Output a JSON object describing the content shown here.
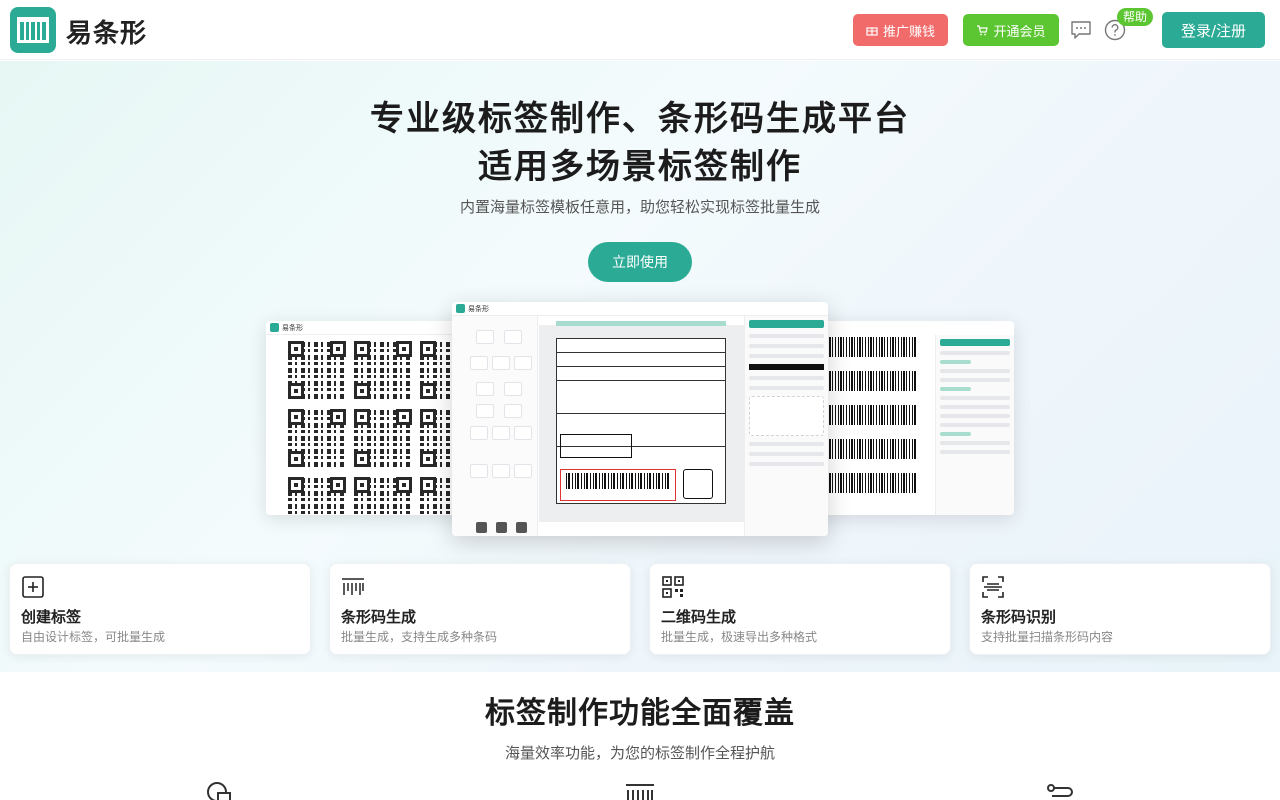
{
  "header": {
    "brand": "易条形",
    "promo_label": "推广赚钱",
    "vip_label": "开通会员",
    "help_badge": "帮助",
    "login_label": "登录/注册"
  },
  "hero": {
    "title_line1": "专业级标签制作、条形码生成平台",
    "title_line2": "适用多场景标签制作",
    "subtitle": "内置海量标签模板任意用，助您轻松实现标签批量生成",
    "cta_label": "立即使用",
    "preview_brand": "易条形"
  },
  "features": [
    {
      "title": "创建标签",
      "desc": "自由设计标签，可批量生成",
      "icon": "plus-square-icon"
    },
    {
      "title": "条形码生成",
      "desc": "批量生成，支持生成多种条码",
      "icon": "barcode-icon"
    },
    {
      "title": "二维码生成",
      "desc": "批量生成，极速导出多种格式",
      "icon": "qrcode-icon"
    },
    {
      "title": "条形码识别",
      "desc": "支持批量扫描条形码内容",
      "icon": "scan-icon"
    }
  ],
  "section2": {
    "title": "标签制作功能全面覆盖",
    "subtitle": "海量效率功能，为您的标签制作全程护航"
  },
  "colors": {
    "primary": "#2bab95",
    "promo": "#f26b6b",
    "vip": "#5cc632"
  }
}
